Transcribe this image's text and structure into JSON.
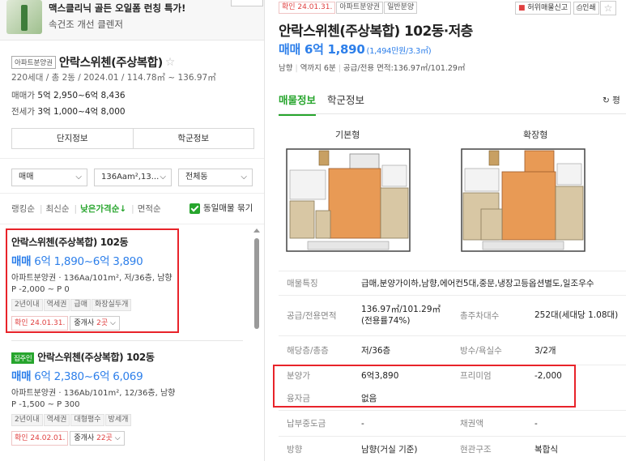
{
  "ad": {
    "title": "맥스클리닉 골든 오일폼 런칭 특가!",
    "subtitle": "속건조 개선 클렌저"
  },
  "complex": {
    "tag": "아파트분양권",
    "name": "안락스위첸(주상복합)",
    "info": "220세대 / 총 2동 / 2024.01 / 114.78㎡ ~ 136.97㎡",
    "sale_label": "매매가",
    "sale_value": "5억 2,950~6억 8,436",
    "jeonse_label": "전세가",
    "jeonse_value": "3억 1,000~4억 8,000",
    "btn_complex": "단지정보",
    "btn_school": "학군정보"
  },
  "filters": {
    "deal": "매매",
    "area": "136Aam²,13...",
    "dong": "전체동"
  },
  "sort": {
    "ranking": "랭킹순",
    "latest": "최신순",
    "low_price": "낮은가격순↓",
    "area": "면적순",
    "same_listing": "동일매물 묶기"
  },
  "listings": [
    {
      "title": "안락스위첸(주상복합) 102동",
      "deal": "매매",
      "price": "6억 1,890~6억 3,890",
      "desc": "아파트분양권 · 136Aa/101m², 저/36층, 남향",
      "sub": "P -2,000 ~ P 0",
      "chips": [
        "2년이내",
        "역세권",
        "급매",
        "화장실두개"
      ],
      "confirm": "확인 24.01.31.",
      "agent_prefix": "중개사",
      "agent_count": "2곳"
    },
    {
      "badge": "집주인",
      "title": "안락스위첸(주상복합) 102동",
      "deal": "매매",
      "price": "6억 2,380~6억 6,069",
      "desc": "아파트분양권 · 136Ab/101m², 12/36층, 남향",
      "sub": "P -1,500 ~ P 300",
      "chips": [
        "2년이내",
        "역세권",
        "대형평수",
        "방세개"
      ],
      "confirm": "확인 24.02.01.",
      "agent_prefix": "중개사",
      "agent_count": "22곳"
    }
  ],
  "detail": {
    "tags": [
      "확인 24.01.31.",
      "아파트분양권",
      "일반분양"
    ],
    "report": "허위매물신고",
    "print": "인쇄",
    "title": "안락스위첸(주상복합) 102동·저층",
    "deal": "매매",
    "price": "6억 1,890",
    "price_per": "(1,494만원/3.3㎡)",
    "meta": [
      "남향",
      "역까지 6분",
      "공급/전용 면적:136.97㎡/101.29㎡"
    ],
    "tab_info": "매물정보",
    "tab_school": "학군정보",
    "refresh": "평",
    "plan_basic": "기본형",
    "plan_ext": "확장형",
    "rows": [
      {
        "l1": "매물특징",
        "v1": "급매,분양가이하,남향,에어컨5대,중문,냉장고등옵션별도,일조우수"
      },
      {
        "l1": "공급/전용면적",
        "v1": "136.97㎡/101.29㎡ (전용률74%)",
        "l2": "총주차대수",
        "v2": "252대(세대당 1.08대)"
      },
      {
        "l1": "해당층/총층",
        "v1": "저/36층",
        "l2": "방수/욕실수",
        "v2": "3/2개"
      },
      {
        "l1": "분양가",
        "v1": "6억3,890",
        "l2": "프리미엄",
        "v2": "-2,000"
      },
      {
        "l1": "융자금",
        "v1": "없음"
      },
      {
        "l1": "납부중도금",
        "v1": "-",
        "l2": "채권액",
        "v2": "-"
      },
      {
        "l1": "방향",
        "v1": "남향(거실 기준)",
        "l2": "현관구조",
        "v2": "복합식"
      }
    ]
  }
}
